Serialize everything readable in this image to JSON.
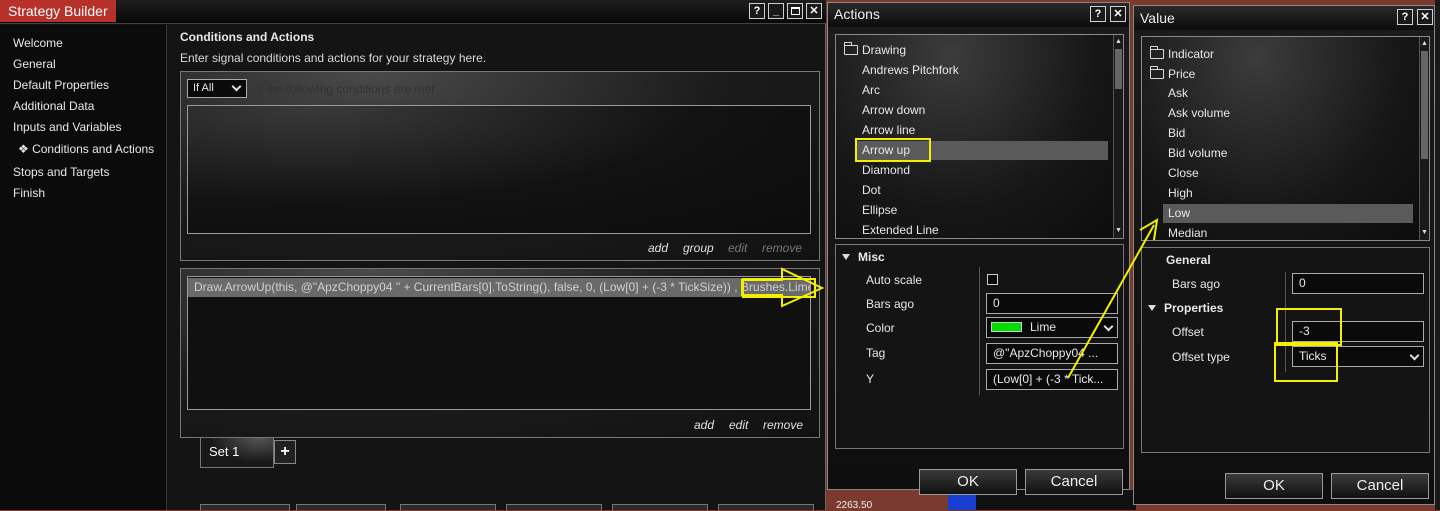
{
  "strategy_builder": {
    "title": "Strategy Builder",
    "nav": [
      "Welcome",
      "General",
      "Default Properties",
      "Additional Data",
      "Inputs and Variables",
      "Conditions and Actions",
      "Stops and Targets",
      "Finish"
    ],
    "active_nav_index": 5,
    "section_title": "Conditions and Actions",
    "section_desc": "Enter signal conditions and actions for your strategy here.",
    "condition_select": "If All",
    "condition_text": "of the following conditions are met",
    "conditions_links": {
      "add": "add",
      "group": "group",
      "edit": "edit",
      "remove": "remove"
    },
    "action_text": "Draw.ArrowUp(this, @\"ApzChoppy04 \" + CurrentBars[0].ToString(), false, 0, (Low[0] + (-3 * TickSize)) , Brushes.Lime);",
    "actions_links": {
      "add": "add",
      "edit": "edit",
      "remove": "remove"
    },
    "set_tab": "Set 1",
    "add_set": "+"
  },
  "actions": {
    "title": "Actions",
    "folder": "Drawing",
    "items": [
      "Andrews Pitchfork",
      "Arc",
      "Arrow down",
      "Arrow line",
      "Arrow up",
      "Diamond",
      "Dot",
      "Ellipse",
      "Extended Line"
    ],
    "selected_index": 4,
    "misc_section": "Misc",
    "props": [
      {
        "label": "Auto scale",
        "value": ""
      },
      {
        "label": "Bars ago",
        "value": "0"
      },
      {
        "label": "Color",
        "value": "Lime"
      },
      {
        "label": "Tag",
        "value": "@\"ApzChoppy04 ..."
      },
      {
        "label": "Y",
        "value": "(Low[0] + (-3 * Tick..."
      }
    ],
    "color_swatch": "#00e000",
    "ok": "OK",
    "cancel": "Cancel"
  },
  "value": {
    "title": "Value",
    "folders": [
      "Indicator",
      "Price"
    ],
    "items": [
      "Ask",
      "Ask volume",
      "Bid",
      "Bid volume",
      "Close",
      "High",
      "Low",
      "Median"
    ],
    "selected_index": 6,
    "general_section": "General",
    "bars_ago_label": "Bars ago",
    "bars_ago": "0",
    "properties_section": "Properties",
    "offset_label": "Offset",
    "offset": "-3",
    "offset_type_label": "Offset type",
    "offset_type": "Ticks",
    "ok": "OK",
    "cancel": "Cancel"
  },
  "background": {
    "price_label": "2263.50"
  },
  "colors": {
    "highlight": "#f2f000",
    "selection": "#5a5a5a",
    "title_red": "#c0302a"
  }
}
